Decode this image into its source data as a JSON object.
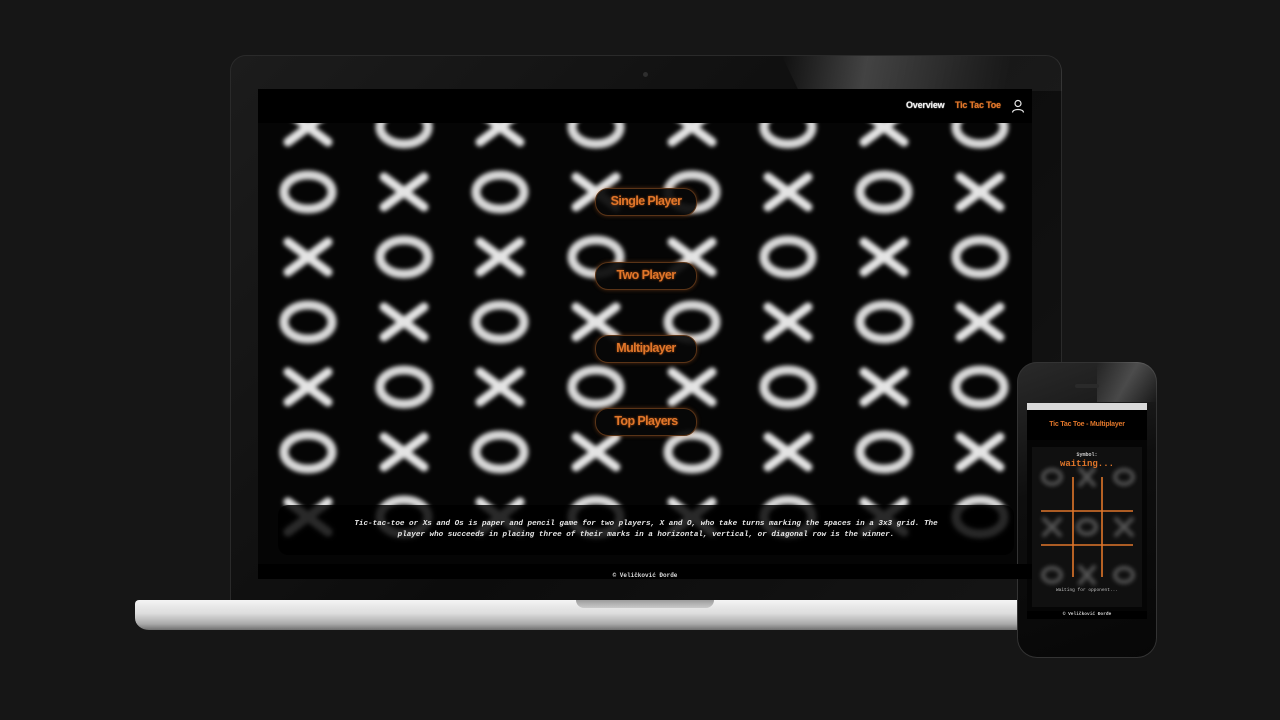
{
  "nav": {
    "overview_label": "Overview",
    "tictactoe_label": "Tic Tac Toe",
    "user_icon": "user-icon"
  },
  "menu": {
    "buttons": [
      {
        "label": "Single Player"
      },
      {
        "label": "Two Player"
      },
      {
        "label": "Multiplayer"
      },
      {
        "label": "Top Players"
      }
    ]
  },
  "description": "Tic-tac-toe or Xs and Os is paper and pencil game for two players, X and O, who take turns marking the spaces in a 3x3 grid. The player who succeeds in placing three of their marks in a horizontal, vertical, or diagonal row is the winner.",
  "footer": "© Veličković Đorđe",
  "phone": {
    "title": "Tic Tac Toe - Multiplayer",
    "symbol_label": "Symbol:",
    "waiting_label": "waiting...",
    "waiting_opponent": "Waiting for opponent...",
    "footer": "© Veličković Đorđe"
  },
  "colors": {
    "accent": "#e0762a",
    "background": "#161616",
    "screen": "#050505"
  }
}
